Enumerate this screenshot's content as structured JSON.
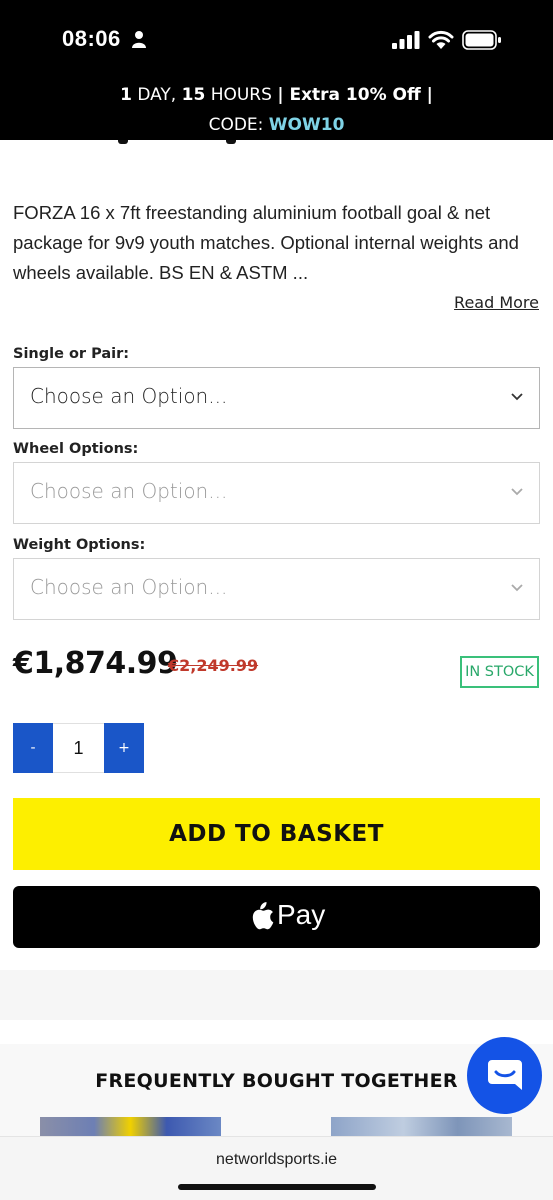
{
  "status_bar": {
    "time": "08:06"
  },
  "promo": {
    "days": "1",
    "day_word": " DAY, ",
    "hours": "15",
    "hour_word": " HOURS ",
    "offer": "| Extra 10% Off |",
    "code_label": "CODE: ",
    "code": "WOW10"
  },
  "product": {
    "description": "FORZA 16 x 7ft freestanding aluminium football goal & net package for 9v9 youth matches. Optional internal weights and wheels available. BS EN & ASTM ...",
    "read_more": "Read More",
    "price": "€1,874.99",
    "old_price": "€2,249.99",
    "stock": "IN STOCK"
  },
  "options": [
    {
      "label": "Single or Pair:",
      "value": "Choose an Option..."
    },
    {
      "label": "Wheel Options:",
      "value": "Choose an Option..."
    },
    {
      "label": "Weight Options:",
      "value": "Choose an Option..."
    }
  ],
  "quantity": {
    "minus": "-",
    "value": "1",
    "plus": "+"
  },
  "buttons": {
    "add_to_basket": "ADD TO BASKET",
    "apple_pay": "Pay"
  },
  "section": {
    "title": "FREQUENTLY BOUGHT TOGETHER"
  },
  "browser": {
    "url": "networldsports.ie"
  },
  "colors": {
    "accent_blue": "#1a56c8",
    "basket_yellow": "#fdef00",
    "stock_green": "#2aa86a",
    "sale_red": "#c0392b",
    "code_cyan": "#7fd3e6"
  }
}
